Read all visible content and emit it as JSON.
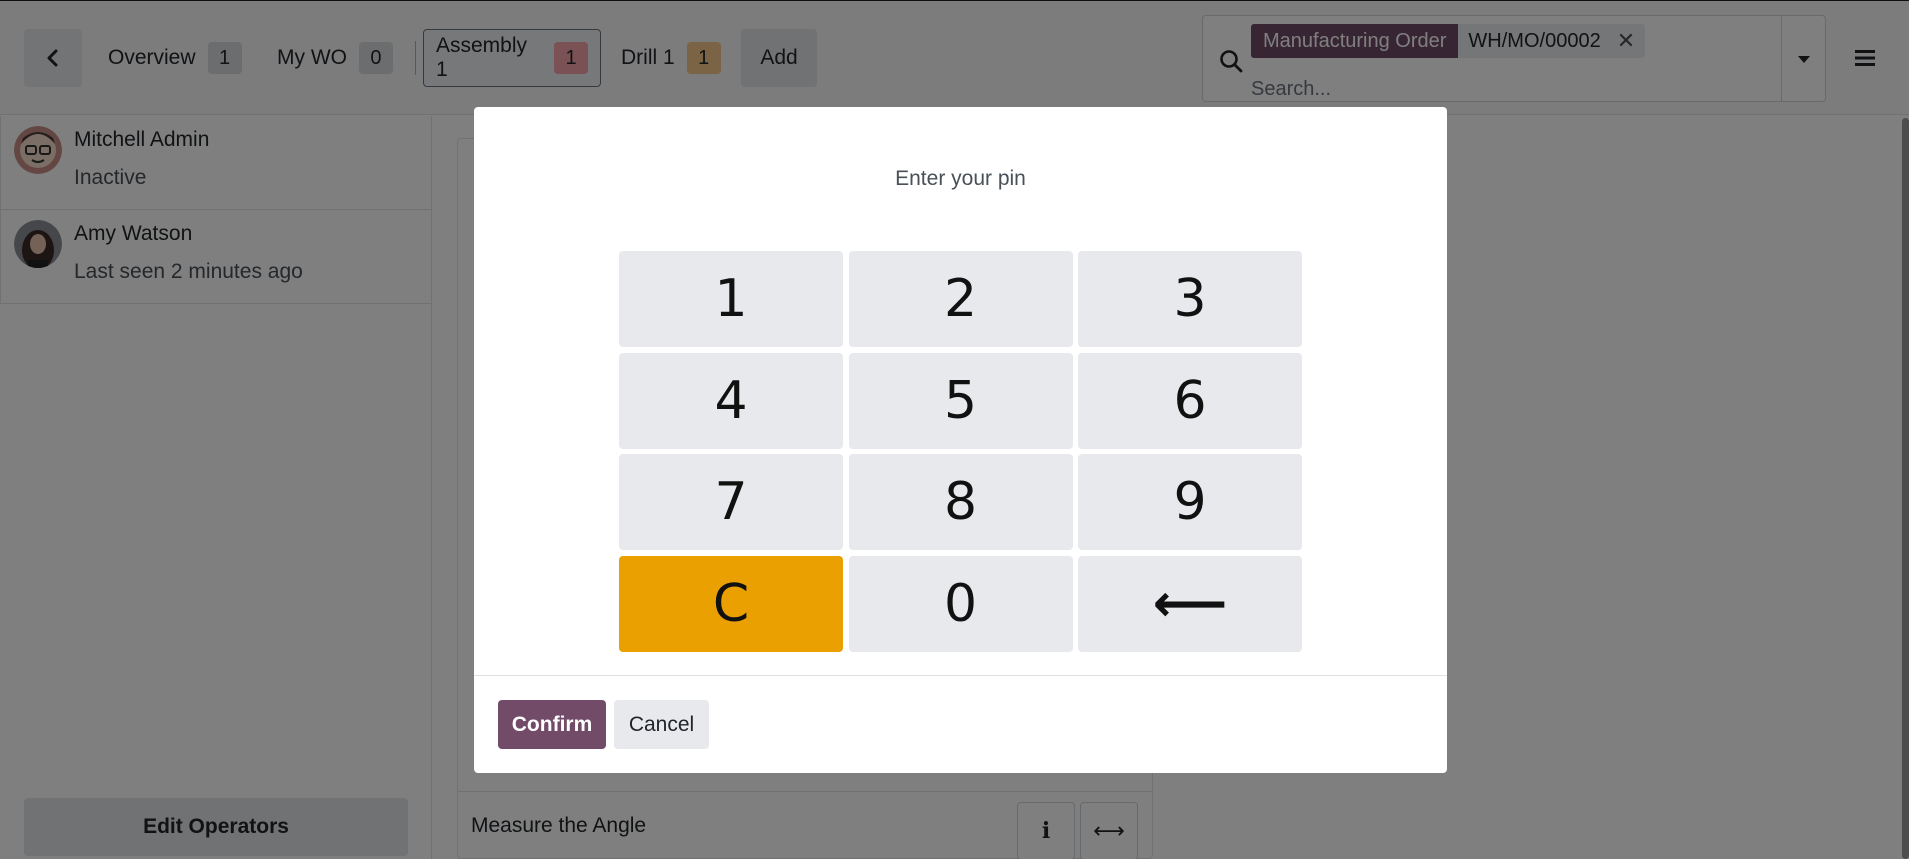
{
  "topbar": {
    "tabs": [
      {
        "label": "Overview",
        "count": "1"
      },
      {
        "label": "My WO",
        "count": "0"
      },
      {
        "label": "Assembly 1",
        "count": "1"
      },
      {
        "label": "Drill 1",
        "count": "1"
      }
    ],
    "add_label": "Add"
  },
  "search": {
    "facet_label": "Manufacturing Order",
    "facet_value": "WH/MO/00002",
    "placeholder": "Search..."
  },
  "operators": [
    {
      "name": "Mitchell Admin",
      "status": "Inactive"
    },
    {
      "name": "Amy Watson",
      "status": "Last seen 2 minutes ago"
    }
  ],
  "edit_operators_label": "Edit Operators",
  "work_order": {
    "step_label": "Measure the Angle",
    "info_glyph": "i",
    "arrows_glyph": "⟷"
  },
  "pin_dialog": {
    "title": "Enter your pin",
    "keys": [
      "1",
      "2",
      "3",
      "4",
      "5",
      "6",
      "7",
      "8",
      "9",
      "C",
      "0",
      "⟵"
    ],
    "confirm_label": "Confirm",
    "cancel_label": "Cancel"
  },
  "colors": {
    "brand": "#714b67",
    "clear_key": "#e9a000",
    "assembly_badge": "#f5a3a8",
    "drill_badge": "#f5c98a"
  }
}
